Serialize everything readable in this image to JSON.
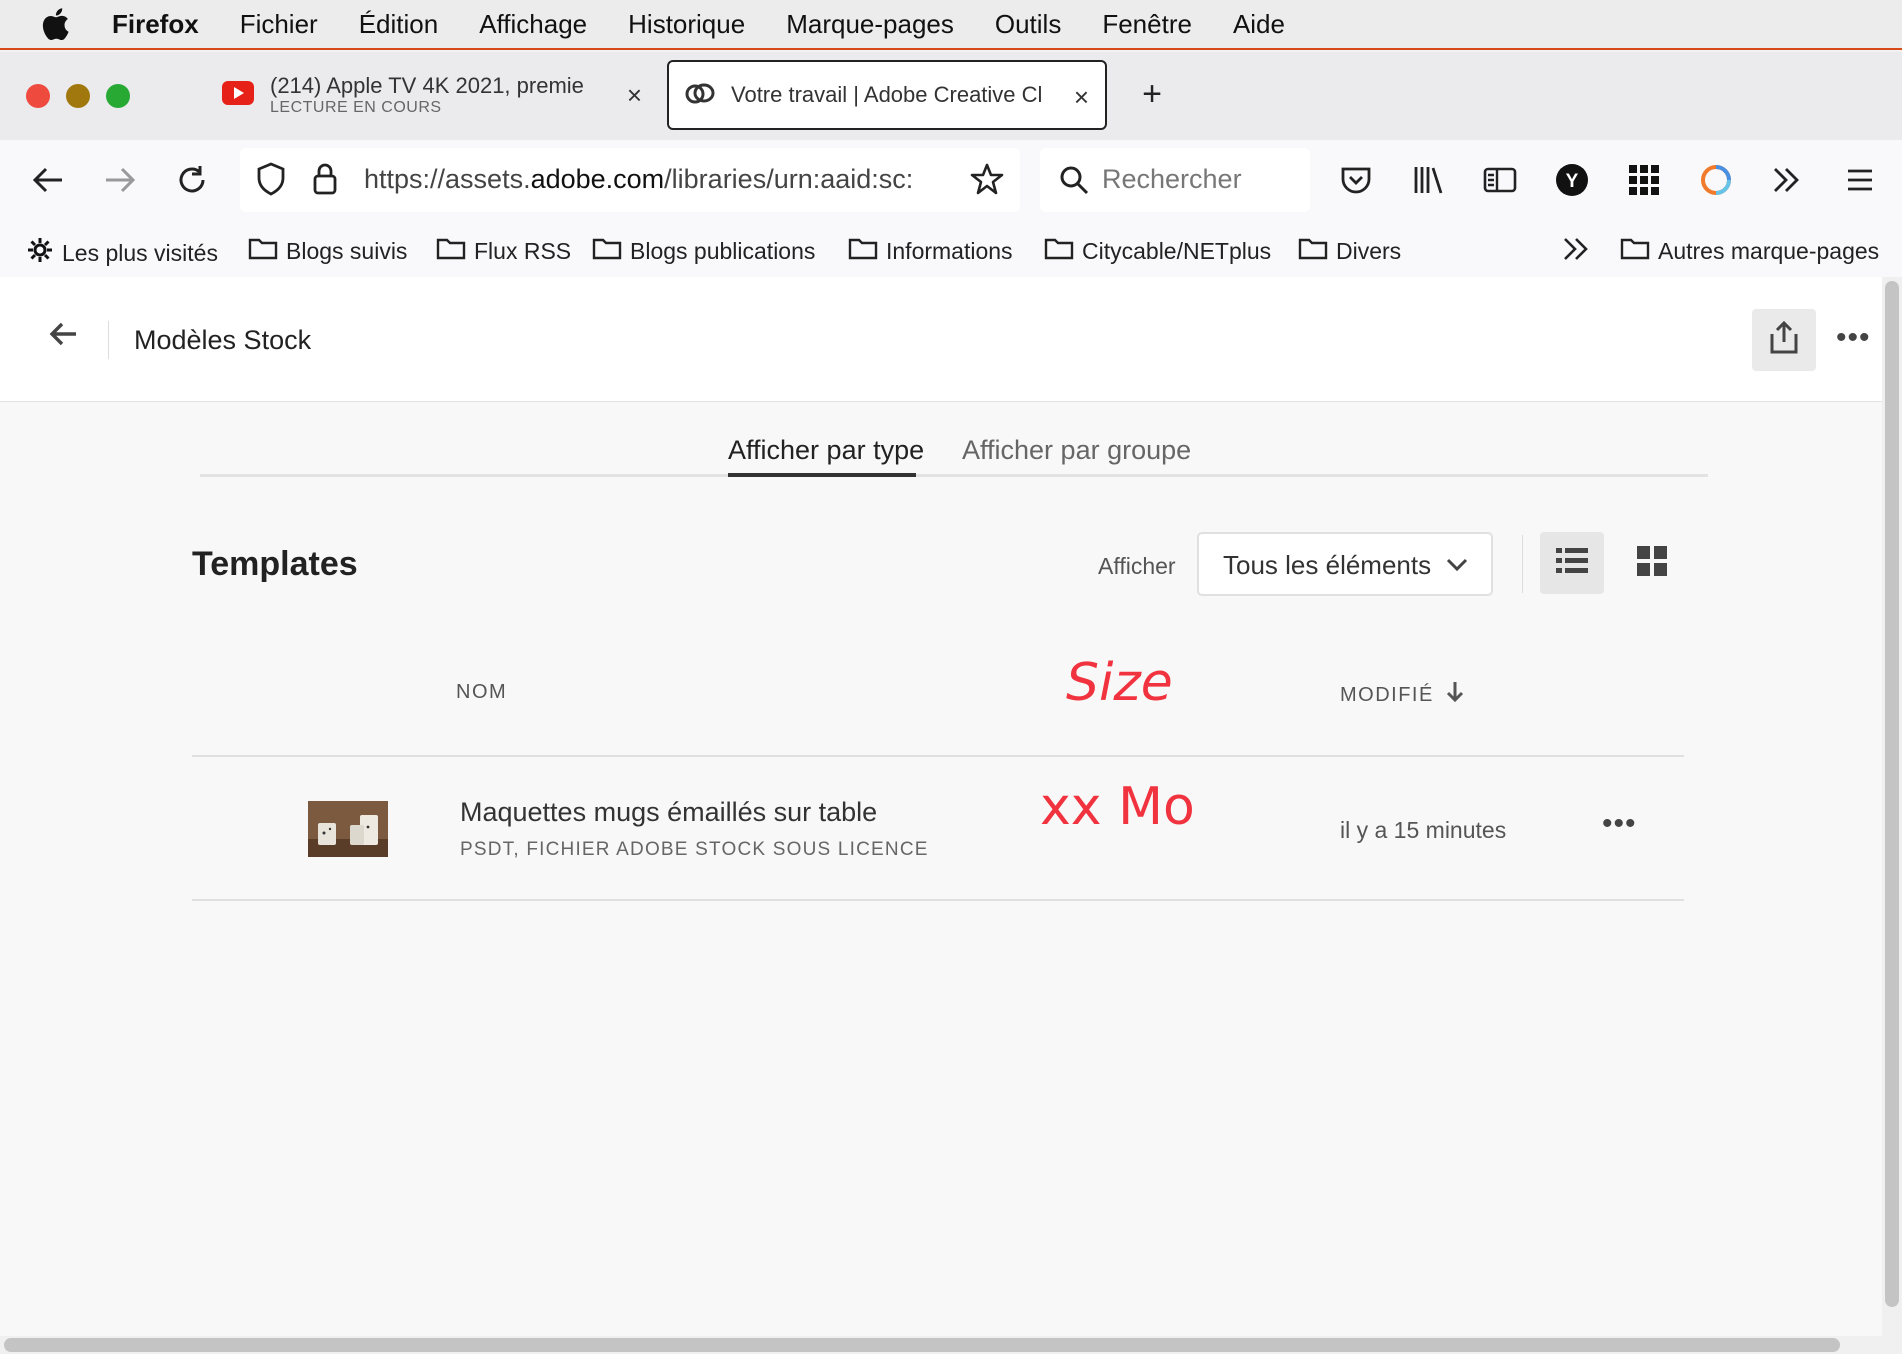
{
  "menubar": {
    "app_name": "Firefox",
    "items": [
      "Fichier",
      "Édition",
      "Affichage",
      "Historique",
      "Marque-pages",
      "Outils",
      "Fenêtre",
      "Aide"
    ]
  },
  "tabs": [
    {
      "title": "(214) Apple TV 4K 2021, premie",
      "subtitle": "LECTURE EN COURS",
      "icon": "youtube-icon"
    },
    {
      "title": "Votre travail | Adobe Creative Cl",
      "icon": "creative-cloud-icon"
    }
  ],
  "url": {
    "scheme": "https://assets.",
    "domain": "adobe.com",
    "path": "/libraries/urn:aaid:sc:"
  },
  "search": {
    "placeholder": "Rechercher"
  },
  "bookmarks": {
    "most_visited": "Les plus visités",
    "folders": [
      "Blogs suivis",
      "Flux RSS",
      "Blogs publications",
      "Informations",
      "Citycable/NETplus",
      "Divers"
    ],
    "other": "Autres marque-pages"
  },
  "page": {
    "title": "Modèles Stock",
    "view_tabs": {
      "by_type": "Afficher par type",
      "by_group": "Afficher par groupe"
    },
    "section_title": "Templates",
    "show_label": "Afficher",
    "filter_value": "Tous les éléments",
    "columns": {
      "name": "NOM",
      "modified": "MODIFIÉ"
    },
    "annotations": {
      "size_header": "Size",
      "size_value": "xx Mo"
    },
    "rows": [
      {
        "name": "Maquettes mugs émaillés sur table",
        "type": "PSDT, FICHIER ADOBE STOCK SOUS LICENCE",
        "modified": "il y a 15 minutes"
      }
    ]
  },
  "colors": {
    "accent": "#f0333f",
    "menubar": "#ececec",
    "page_bg": "#f8f8f8"
  }
}
